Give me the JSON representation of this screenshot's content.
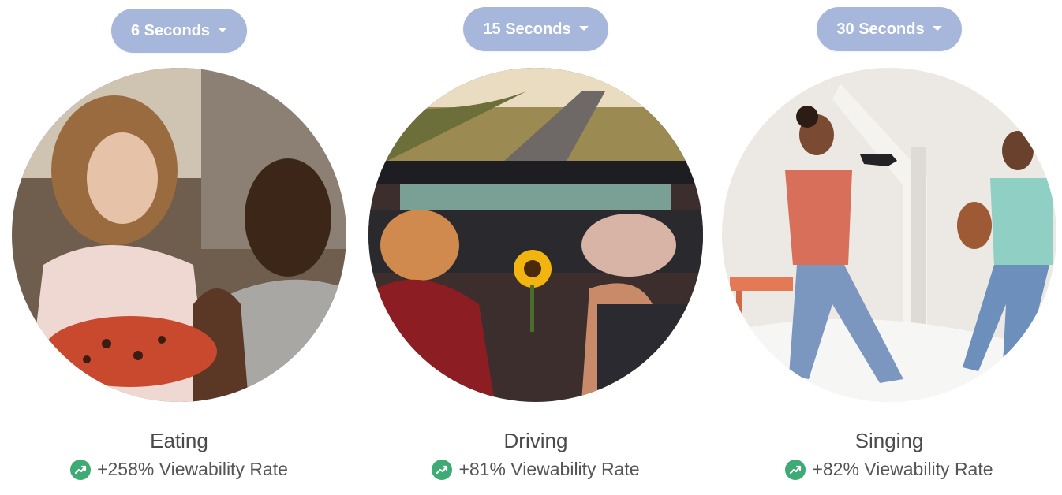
{
  "colors": {
    "dropdown_bg": "#a6b7db",
    "trend_green": "#3dab73",
    "title_text": "#4a4a4a"
  },
  "cards": [
    {
      "duration_label": "6 Seconds",
      "photo_description_icon": "photo-eating-pizza",
      "title": "Eating",
      "stat": "+258% Viewability Rate"
    },
    {
      "duration_label": "15 Seconds",
      "photo_description_icon": "photo-driving-convertible",
      "title": "Driving",
      "stat": "+81% Viewability Rate"
    },
    {
      "duration_label": "30 Seconds",
      "photo_description_icon": "photo-singing-dancing",
      "title": "Singing",
      "stat": "+82% Viewability Rate"
    }
  ]
}
